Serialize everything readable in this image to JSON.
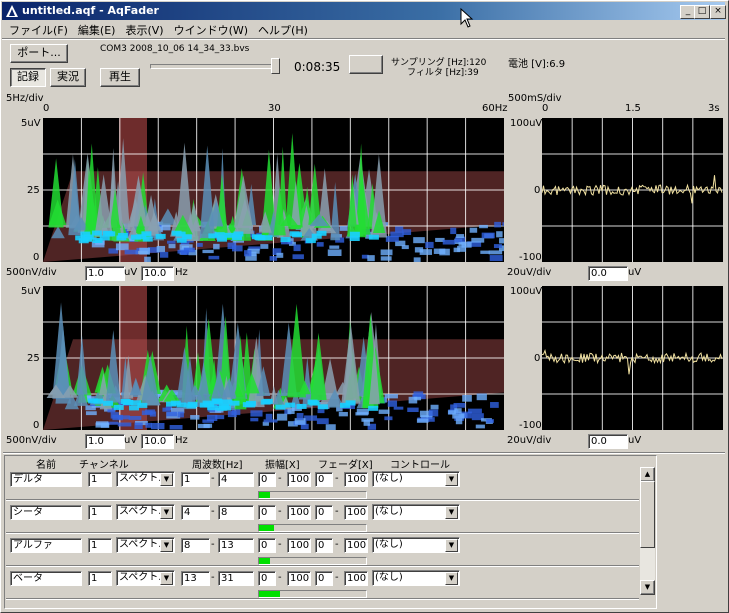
{
  "window": {
    "title": "untitled.aqf - AqFader"
  },
  "menu": [
    "ファイル(F)",
    "編集(E)",
    "表示(V)",
    "ウインドウ(W)",
    "ヘルプ(H)"
  ],
  "toolbar": {
    "port_label": "ポート...",
    "file_label": "COM3 2008_10_06 14_34_33.bvs",
    "record_label": "記録",
    "live_label": "実況",
    "play_label": "再生",
    "time": "0:08:35",
    "sampling": "サンプリング [Hz]:120",
    "filter": "フィルタ [Hz]:39",
    "battery": "電池 [V]:6.9"
  },
  "spectrum": {
    "xscale_label": "5Hz/div",
    "x_ticks": [
      "0",
      "30",
      "60Hz"
    ],
    "y_ticks": [
      "5uV",
      "25",
      "0"
    ]
  },
  "wave": {
    "xscale_label": "500mS/div",
    "x_ticks": [
      "0",
      "1.5",
      "3s"
    ],
    "y_ticks": [
      "100uV",
      "0",
      "-100"
    ]
  },
  "panel1": {
    "yscale": "500nV/div",
    "value": "1.0",
    "unit_uv": "uV",
    "hz_value": "10.0",
    "unit_hz": "Hz",
    "wave_yscale": "20uV/div",
    "wave_value": "0.0",
    "wave_unit": "uV"
  },
  "panel2": {
    "yscale": "500nV/div",
    "value": "1.0",
    "unit_uv": "uV",
    "hz_value": "10.0",
    "unit_hz": "Hz",
    "wave_yscale": "20uV/div",
    "wave_value": "0.0",
    "wave_unit": "uV"
  },
  "table": {
    "headers": [
      "名前",
      "チャンネル",
      "周波数[Hz]",
      "振幅[X]",
      "フェーダ[X]",
      "コントロール"
    ],
    "rows": [
      {
        "name": "デルタ",
        "channel": "1",
        "mode": "スペクトル",
        "f_lo": "1",
        "f_hi": "4",
        "a_lo": "0",
        "a_hi": "100",
        "fd_lo": "0",
        "fd_hi": "100",
        "control": "(なし)",
        "level": 0.1
      },
      {
        "name": "シータ",
        "channel": "1",
        "mode": "スペクトル",
        "f_lo": "4",
        "f_hi": "8",
        "a_lo": "0",
        "a_hi": "100",
        "fd_lo": "0",
        "fd_hi": "100",
        "control": "(なし)",
        "level": 0.14
      },
      {
        "name": "アルファ",
        "channel": "1",
        "mode": "スペクトル",
        "f_lo": "8",
        "f_hi": "13",
        "a_lo": "0",
        "a_hi": "100",
        "fd_lo": "0",
        "fd_hi": "100",
        "control": "(なし)",
        "level": 0.1
      },
      {
        "name": "ベータ",
        "channel": "1",
        "mode": "スペクトル",
        "f_lo": "13",
        "f_hi": "31",
        "a_lo": "0",
        "a_hi": "100",
        "fd_lo": "0",
        "fd_hi": "100",
        "control": "(なし)",
        "level": 0.2
      }
    ],
    "separator": "-"
  },
  "colors": {
    "accent": "#0a246a",
    "grid": "#ffffff",
    "spectrum_green": "#22dd33",
    "spectrum_blue": "#1e90ff",
    "wave_line": "#f0e0a0",
    "band_highlight": "#c85050"
  }
}
